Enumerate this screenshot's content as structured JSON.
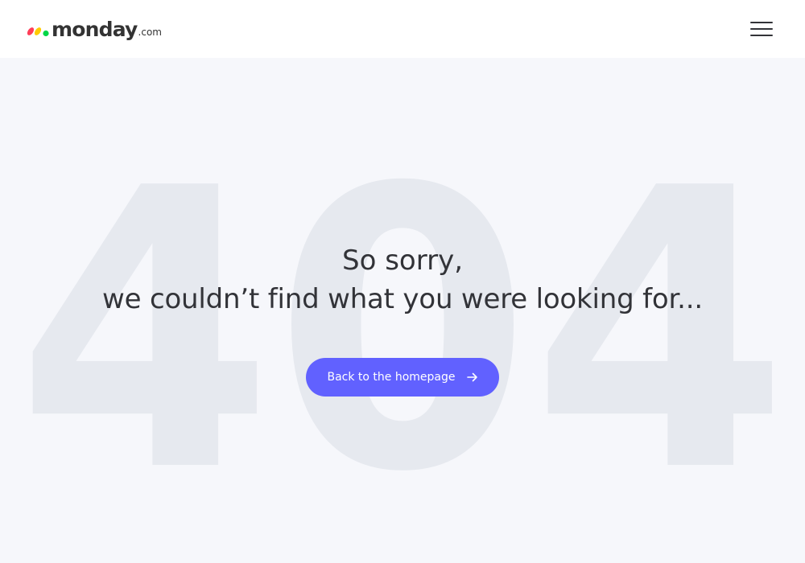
{
  "brand": {
    "name": "monday",
    "tld": ".com",
    "colors": {
      "red": "#ff3d57",
      "yellow": "#ffcb00",
      "green": "#00d647"
    }
  },
  "header": {
    "menu_icon": "hamburger-menu-icon"
  },
  "background_text": "404",
  "message": {
    "line1": "So sorry,",
    "line2": "we couldn’t find what you were looking for..."
  },
  "cta": {
    "label": "Back to the homepage",
    "icon": "arrow-right-icon",
    "color": "#6161ff"
  }
}
